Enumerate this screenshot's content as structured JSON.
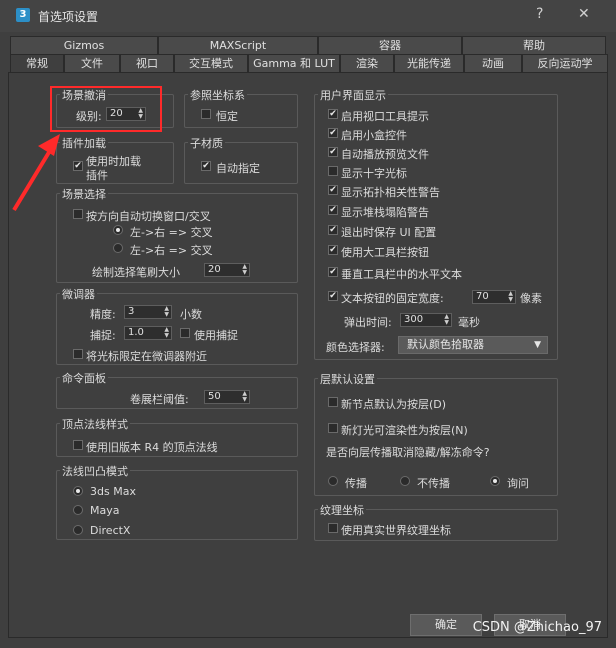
{
  "window": {
    "title": "首选项设置",
    "icon_text": "3",
    "help_btn": "?",
    "close_btn": "✕"
  },
  "tabs_row1": [
    {
      "label": "Gizmos"
    },
    {
      "label": "MAXScript"
    },
    {
      "label": "容器"
    },
    {
      "label": "帮助"
    }
  ],
  "tabs_row2": [
    {
      "label": "常规",
      "active": true
    },
    {
      "label": "文件"
    },
    {
      "label": "视口"
    },
    {
      "label": "交互模式"
    },
    {
      "label": "Gamma 和 LUT"
    },
    {
      "label": "渲染"
    },
    {
      "label": "光能传递"
    },
    {
      "label": "动画"
    },
    {
      "label": "反向运动学"
    }
  ],
  "scene_undo": {
    "title": "场景撤消",
    "level_label": "级别:",
    "level_value": "20"
  },
  "ref_coord": {
    "title": "参照坐标系",
    "constant_label": "恒定"
  },
  "plugin_load": {
    "title": "插件加载",
    "load_on_use": "使用时加载",
    "load_on_use_2": "插件"
  },
  "sub_material": {
    "title": "子材质",
    "auto_assign": "自动指定"
  },
  "scene_select": {
    "title": "场景选择",
    "auto_switch": "按方向自动切换窗口/交叉",
    "left_right": "左->右 => 交叉",
    "right_left": "左->右 => 交叉",
    "brush_size_label": "绘制选择笔刷大小",
    "brush_size_value": "20"
  },
  "spinners": {
    "title": "微调器",
    "precision_label": "精度:",
    "precision_value": "3",
    "decimal_label": "小数",
    "snap_label": "捕捉:",
    "snap_value": "1.0",
    "use_snap": "使用捕捉",
    "wrap_cursor": "将光标限定在微调器附近"
  },
  "command_panel": {
    "title": "命令面板",
    "rollup_label": "卷展栏阈值:",
    "rollup_value": "50"
  },
  "vertex_normal": {
    "title": "顶点法线样式",
    "use_legacy": "使用旧版本 R4 的顶点法线"
  },
  "bump_mode": {
    "title": "法线凹凸模式",
    "options": [
      "3ds Max",
      "Maya",
      "DirectX"
    ]
  },
  "ui_display": {
    "title": "用户界面显示",
    "items": [
      {
        "label": "启用视口工具提示",
        "checked": true
      },
      {
        "label": "启用小盒控件",
        "checked": true
      },
      {
        "label": "自动播放预览文件",
        "checked": true
      },
      {
        "label": "显示十字光标",
        "checked": false
      },
      {
        "label": "显示拓扑相关性警告",
        "checked": true
      },
      {
        "label": "显示堆栈塌陷警告",
        "checked": true
      },
      {
        "label": "退出时保存 UI 配置",
        "checked": true
      },
      {
        "label": "使用大工具栏按钮",
        "checked": true
      },
      {
        "label": "垂直工具栏中的水平文本",
        "checked": true
      }
    ],
    "fixed_width_label": "文本按钮的固定宽度:",
    "fixed_width_value": "70",
    "fixed_width_unit": "像素",
    "flyout_label": "弹出时间:",
    "flyout_value": "300",
    "flyout_unit": "毫秒",
    "color_picker_label": "颜色选择器:",
    "color_picker_value": "默认颜色拾取器"
  },
  "layer_defaults": {
    "title": "层默认设置",
    "new_nodes": "新节点默认为按层(D)",
    "new_lights": "新灯光可渲染性为按层(N)",
    "propagate_q": "是否向层传播取消隐藏/解冻命令?",
    "options": [
      "传播",
      "不传播",
      "询问"
    ]
  },
  "texture_coords": {
    "title": "纹理坐标",
    "real_world": "使用真实世界纹理坐标"
  },
  "buttons": {
    "ok": "确定",
    "cancel": "取消"
  },
  "watermark": "CSDN @Zhichao_97",
  "colors": {
    "bg": "#3f3f3f",
    "highlight": "#ff2a2a"
  }
}
